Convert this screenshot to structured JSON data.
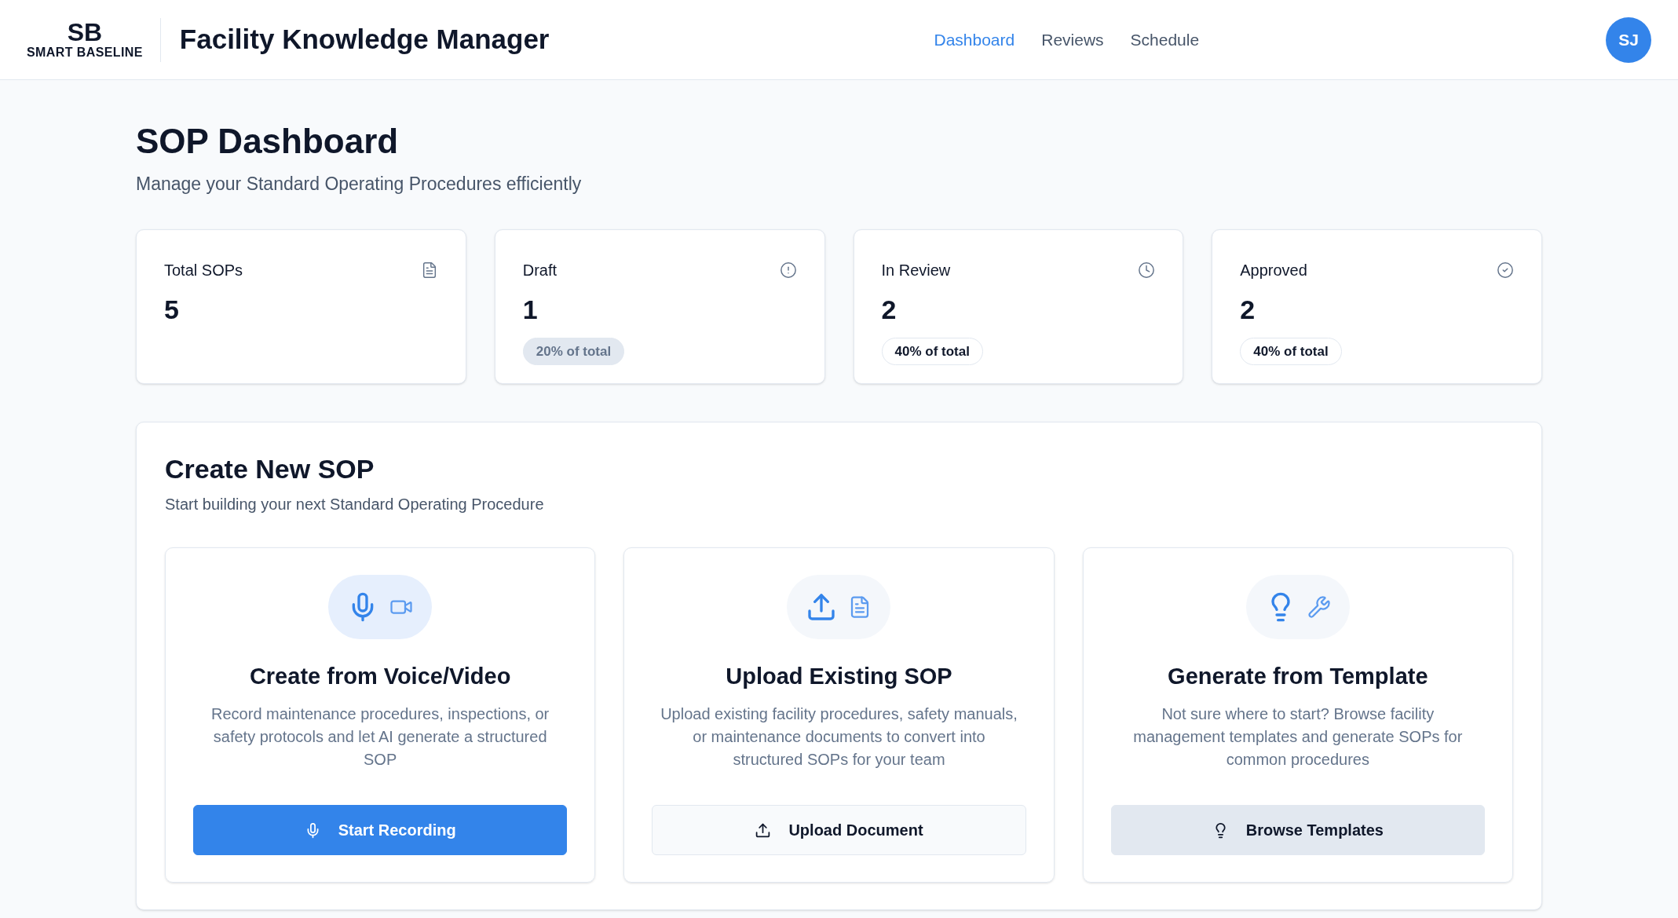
{
  "header": {
    "logo_mark": "SB",
    "logo_text": "SMART BASELINE",
    "title": "Facility Knowledge Manager",
    "nav": [
      {
        "label": "Dashboard",
        "selected": true
      },
      {
        "label": "Reviews",
        "selected": false
      },
      {
        "label": "Schedule",
        "selected": false
      }
    ],
    "avatar": "SJ"
  },
  "page": {
    "title": "SOP Dashboard",
    "subtitle": "Manage your Standard Operating Procedures efficiently"
  },
  "stats": [
    {
      "label": "Total SOPs",
      "value": "5"
    },
    {
      "label": "Draft",
      "value": "1",
      "badge": "20% of total"
    },
    {
      "label": "In Review",
      "value": "2",
      "badge": "40% of total"
    },
    {
      "label": "Approved",
      "value": "2",
      "badge": "40% of total"
    }
  ],
  "create": {
    "title": "Create New SOP",
    "subtitle": "Start building your next Standard Operating Procedure",
    "options": [
      {
        "title": "Create from Voice/Video",
        "description": "Record maintenance procedures, inspections, or safety protocols and let AI generate a structured SOP",
        "button": "Start Recording"
      },
      {
        "title": "Upload Existing SOP",
        "description": "Upload existing facility procedures, safety manuals, or maintenance documents to convert into structured SOPs for your team",
        "button": "Upload Document"
      },
      {
        "title": "Generate from Template",
        "description": "Not sure where to start? Browse facility management templates and generate SOPs for common procedures",
        "button": "Browse Templates"
      }
    ]
  }
}
